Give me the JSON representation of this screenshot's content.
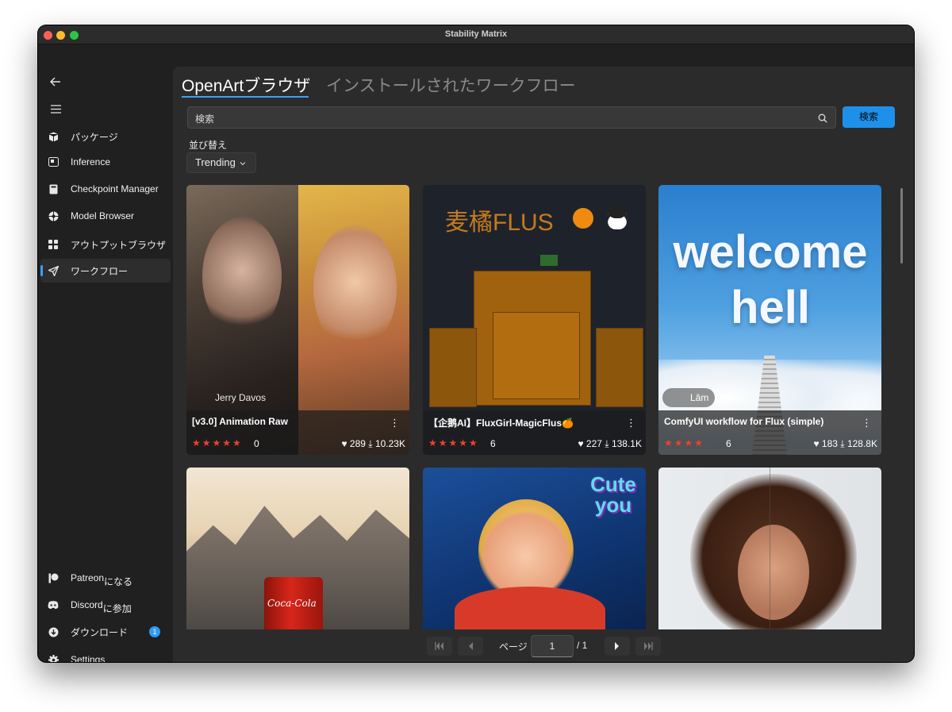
{
  "window": {
    "title": "Stability Matrix"
  },
  "sidebar": {
    "items": [
      {
        "label": "パッケージ",
        "icon": "package-icon"
      },
      {
        "label": "Inference",
        "icon": "inference-icon"
      },
      {
        "label": "Checkpoint Manager",
        "icon": "checkpoint-icon"
      },
      {
        "label": "Model Browser",
        "icon": "model-browser-icon"
      },
      {
        "label": "アウトプットブラウザ",
        "icon": "grid-icon"
      },
      {
        "label": "ワークフロー",
        "icon": "send-icon",
        "active": true
      }
    ],
    "footer": [
      {
        "label": "Patreon",
        "sub": "になる",
        "icon": "patreon-icon"
      },
      {
        "label": "Discord",
        "sub": "に参加",
        "icon": "discord-icon"
      },
      {
        "label": "ダウンロード",
        "icon": "download-icon",
        "badge": "1"
      },
      {
        "label": "Settings",
        "icon": "gear-icon"
      }
    ]
  },
  "tabs": [
    {
      "label": "OpenArtブラウザ",
      "active": true
    },
    {
      "label": "インストールされたワークフロー",
      "active": false
    }
  ],
  "search": {
    "placeholder": "検索",
    "button": "検索"
  },
  "sort": {
    "label": "並び替え",
    "value": "Trending"
  },
  "cards": [
    {
      "title": "[v3.0] Animation Raw",
      "rating": 5,
      "rating_count": "0",
      "likes": "289",
      "downloads": "10.23K",
      "overlay": "Jerry Davos"
    },
    {
      "title": "【企鹅AI】FluxGirl-MagicFlus🍊",
      "rating": 5,
      "rating_count": "6",
      "likes": "227",
      "downloads": "138.1K",
      "overlay": "麦橘FLUS"
    },
    {
      "title": "ComfyUI workflow for Flux (simple)",
      "rating": 4,
      "rating_count": "6",
      "likes": "183",
      "downloads": "128.8K",
      "overlay": "Lâm",
      "image_text": "welcome hell"
    },
    {
      "title": "",
      "image_text": "Coca-Cola"
    },
    {
      "title": "",
      "image_text": "Cute you"
    },
    {
      "title": ""
    }
  ],
  "pagination": {
    "label": "ページ",
    "current": "1",
    "total": "/ 1"
  }
}
